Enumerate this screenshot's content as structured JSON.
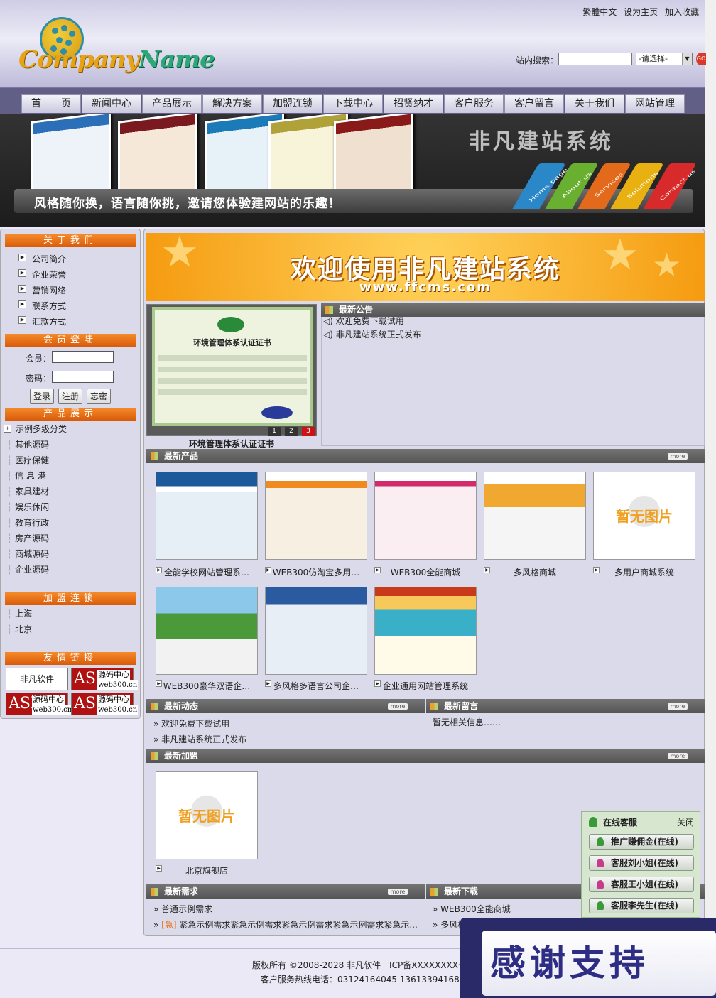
{
  "top_links": [
    "繁體中文",
    "设为主页",
    "加入收藏"
  ],
  "search": {
    "label": "站内搜索：",
    "select_value": "-请选择-"
  },
  "logo": {
    "part1": "Company",
    "part2": "Name"
  },
  "nav": [
    "首　　页",
    "新闻中心",
    "产品展示",
    "解决方案",
    "加盟连锁",
    "下载中心",
    "招贤纳才",
    "客户服务",
    "客户留言",
    "关于我们",
    "网站管理"
  ],
  "banner": {
    "title": "非凡建站系统",
    "slogan": "风格随你换，语言随你挑，邀请您体验建网站的乐趣！",
    "tabs": [
      "Home page",
      "About us",
      "Services",
      "Solutions",
      "Contact us"
    ]
  },
  "sidebar": {
    "about_head": "关于我们",
    "about_items": [
      "公司简介",
      "企业荣誉",
      "营销网络",
      "联系方式",
      "汇款方式"
    ],
    "login_head": "会员登陆",
    "login": {
      "user_label": "会员：",
      "pass_label": "密码：",
      "login_btn": "登录",
      "register_btn": "注册",
      "forgot_btn": "忘密"
    },
    "product_head": "产品展示",
    "product_items": [
      "示例多级分类",
      "其他源码",
      "医疗保健",
      "信 息 港",
      "家具建材",
      "娱乐休闲",
      "教育行政",
      "房产源码",
      "商城源码",
      "企业源码"
    ],
    "franchise_head": "加盟连锁",
    "franchise_items": [
      "上海",
      "北京"
    ],
    "links_head": "友情链接",
    "links": {
      "feifan": "非凡软件",
      "asp_big": "ASP",
      "asp_title": "源码中心",
      "asp_url": "web300.cn"
    }
  },
  "welcome": {
    "text": "欢迎使用非凡建站系统",
    "url": "www.ffcms.com"
  },
  "cert": {
    "caption": "环境管理体系认证证书",
    "doc_title": "环境管理体系认证证书",
    "pages": [
      "1",
      "2",
      "3"
    ]
  },
  "notice": {
    "head": "最新公告",
    "items": [
      "欢迎免费下载试用",
      "非凡建站系统正式发布"
    ]
  },
  "products": {
    "head": "最新产品",
    "more": "more",
    "items": [
      "全能学校网站管理系…",
      "WEB300仿淘宝多用…",
      "WEB300全能商城",
      "多风格商城",
      "多用户商城系统",
      "WEB300豪华双语企…",
      "多风格多语言公司企…",
      "企业通用网站管理系统"
    ],
    "no_image": "暂无图片"
  },
  "news": {
    "head": "最新动态",
    "more": "more",
    "items": [
      "» 欢迎免费下载试用",
      "» 非凡建站系统正式发布"
    ]
  },
  "messages": {
    "head": "最新留言",
    "more": "more",
    "empty": "暂无相关信息……"
  },
  "join": {
    "head": "最新加盟",
    "more": "more",
    "item": "北京旗舰店",
    "no_image": "暂无图片"
  },
  "demand": {
    "head": "最新需求",
    "more": "more",
    "item1": "» 普通示例需求",
    "urgent_prefix": "» ",
    "urgent_tag": "[急]",
    "item2": " 紧急示例需求紧急示例需求紧急示例需求紧急示例需求紧急示..."
  },
  "downloads": {
    "head": "最新下载",
    "items": [
      "» WEB300全能商城",
      "» 多风格"
    ]
  },
  "service": {
    "head": "在线客服",
    "close": "关闭",
    "buttons": [
      "推广赚佣金(在线)",
      "客服刘小姐(在线)",
      "客服王小姐(在线)",
      "客服李先生(在线)"
    ]
  },
  "footer": {
    "line1": "版权所有 ©2008-2028 非凡软件　ICP备XXXXXXXX号",
    "line2": "客户服务热线电话：03124164045 13613394168"
  },
  "thanks": "感谢支持",
  "colors": {
    "accent_orange": "#e8700f",
    "nav_bg": "#625f86",
    "bar_gray": "#666666",
    "service_green": "#3a9a3a"
  }
}
